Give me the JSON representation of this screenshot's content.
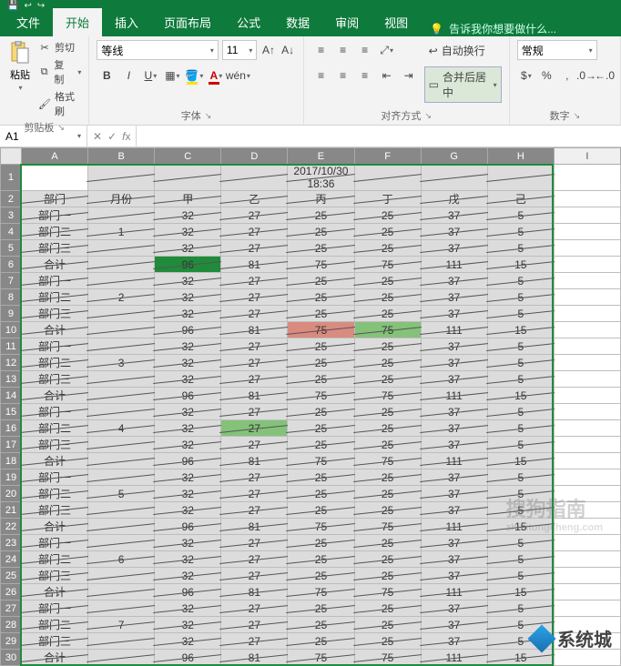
{
  "qat": [
    "↩",
    "↪",
    "⋯"
  ],
  "tabs": {
    "file": "文件",
    "home": "开始",
    "insert": "插入",
    "layout": "页面布局",
    "formulas": "公式",
    "data": "数据",
    "review": "审阅",
    "view": "视图"
  },
  "tellme": "告诉我你想要做什么...",
  "ribbon": {
    "clipboard": {
      "paste": "粘贴",
      "cut": "剪切",
      "copy": "复制",
      "painter": "格式刷",
      "label": "剪贴板"
    },
    "font": {
      "name": "等线",
      "size": "11",
      "label": "字体"
    },
    "align": {
      "wrap": "自动换行",
      "merge": "合并后居中",
      "label": "对齐方式"
    },
    "number": {
      "format": "常规",
      "label": "数字"
    }
  },
  "namebox": "A1",
  "fx": "",
  "columns": [
    "A",
    "B",
    "C",
    "D",
    "E",
    "F",
    "G",
    "H",
    "I"
  ],
  "timestamp": "2017/10/30 18:36",
  "headers": {
    "dept": "部门",
    "month": "月份",
    "jia": "甲",
    "yi": "乙",
    "bing": "丙",
    "ding": "丁",
    "wu": "戊",
    "ji": "己"
  },
  "rowlabels": {
    "d1": "部门一",
    "d2": "部门二",
    "d3": "部门三",
    "sum": "合计"
  },
  "blocks": [
    {
      "month": "1",
      "rows": [
        [
          32,
          27,
          25,
          25,
          37,
          5
        ],
        [
          32,
          27,
          25,
          25,
          37,
          5
        ],
        [
          32,
          27,
          25,
          25,
          37,
          5
        ]
      ],
      "sum": [
        96,
        81,
        75,
        75,
        111,
        15
      ]
    },
    {
      "month": "2",
      "rows": [
        [
          32,
          27,
          25,
          25,
          37,
          5
        ],
        [
          32,
          27,
          25,
          25,
          37,
          5
        ],
        [
          32,
          27,
          25,
          25,
          37,
          5
        ]
      ],
      "sum": [
        96,
        81,
        75,
        75,
        111,
        15
      ]
    },
    {
      "month": "3",
      "rows": [
        [
          32,
          27,
          25,
          25,
          37,
          5
        ],
        [
          32,
          27,
          25,
          25,
          37,
          5
        ],
        [
          32,
          27,
          25,
          25,
          37,
          5
        ]
      ],
      "sum": [
        96,
        81,
        75,
        75,
        111,
        15
      ]
    },
    {
      "month": "4",
      "rows": [
        [
          32,
          27,
          25,
          25,
          37,
          5
        ],
        [
          32,
          27,
          25,
          25,
          37,
          5
        ],
        [
          32,
          27,
          25,
          25,
          37,
          5
        ]
      ],
      "sum": [
        96,
        81,
        75,
        75,
        111,
        15
      ]
    },
    {
      "month": "5",
      "rows": [
        [
          32,
          27,
          25,
          25,
          37,
          5
        ],
        [
          32,
          27,
          25,
          25,
          37,
          5
        ],
        [
          32,
          27,
          25,
          25,
          37,
          5
        ]
      ],
      "sum": [
        96,
        81,
        75,
        75,
        111,
        15
      ]
    },
    {
      "month": "6",
      "rows": [
        [
          32,
          27,
          25,
          25,
          37,
          5
        ],
        [
          32,
          27,
          25,
          25,
          37,
          5
        ],
        [
          32,
          27,
          25,
          25,
          37,
          5
        ]
      ],
      "sum": [
        96,
        81,
        75,
        75,
        111,
        15
      ]
    },
    {
      "month": "7",
      "rows": [
        [
          32,
          27,
          25,
          25,
          37,
          5
        ],
        [
          32,
          27,
          25,
          25,
          37,
          5
        ],
        [
          32,
          27,
          25,
          25,
          37,
          5
        ]
      ],
      "sum": [
        96,
        81,
        75,
        75,
        111,
        15
      ]
    }
  ],
  "highlights": [
    {
      "r": 6,
      "c": "C",
      "class": "hl-green"
    },
    {
      "r": 10,
      "c": "E",
      "class": "hl-red"
    },
    {
      "r": 10,
      "c": "F",
      "class": "hl-lgreen"
    },
    {
      "r": 16,
      "c": "D",
      "class": "hl-lgreen"
    }
  ],
  "watermark_main": "搜狗指南",
  "watermark_sub": "zhixitongcheng.com",
  "footer_brand": "系统城"
}
